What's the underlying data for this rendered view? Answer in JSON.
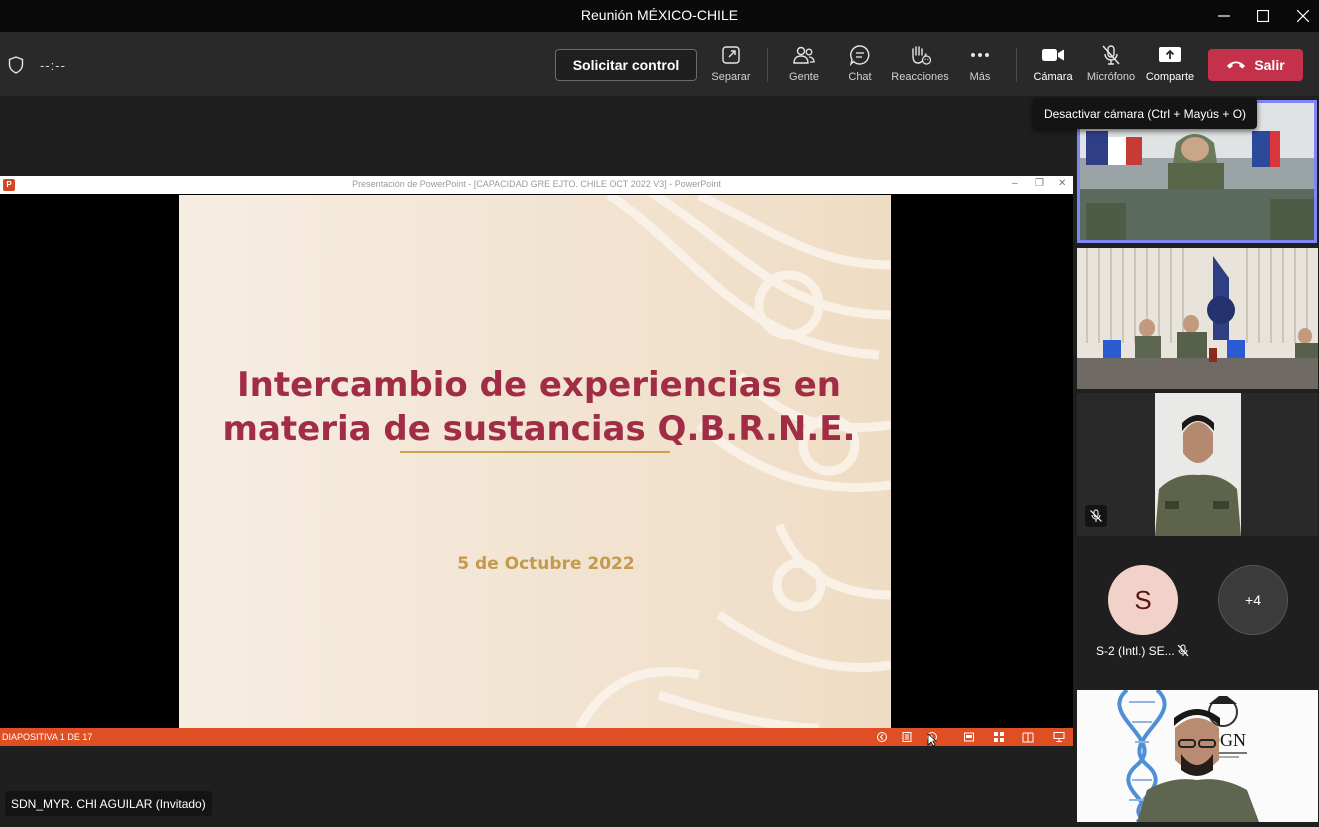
{
  "window": {
    "title": "Reunión MÉXICO-CHILE"
  },
  "toolbar": {
    "timer": "--:--",
    "request_control": "Solicitar control",
    "buttons": {
      "pop_out": "Separar",
      "people": "Gente",
      "chat": "Chat",
      "reactions": "Reacciones",
      "more": "Más",
      "camera": "Cámara",
      "mic": "Micrófono",
      "share": "Comparte"
    },
    "leave": "Salir",
    "leave_color": "#c4314b"
  },
  "tooltip": "Desactivar cámara (Ctrl + Mayús + O)",
  "shared_screen": {
    "window_title": "Presentación de PowerPoint - [CAPACIDAD GRE EJTO. CHILE OCT 2022 V3] - PowerPoint",
    "app_icon": "P",
    "slide": {
      "title_line1": "Intercambio de experiencias en",
      "title_line2": "materia de sustancias Q.B.R.N.E.",
      "date": "5 de Octubre 2022",
      "title_color": "#a12c46",
      "date_color": "#c49a4c"
    },
    "status": "DIAPOSITIVA 1 DE 17",
    "status_color": "#e04f24"
  },
  "presenter_name": "SDN_MYR. CHI AGUILAR (Invitado)",
  "gallery": {
    "avatar_initial": "S",
    "avatar_name": "S-2 (Intl.) SE...",
    "overflow": "+4",
    "dgn_text": "DGN"
  }
}
